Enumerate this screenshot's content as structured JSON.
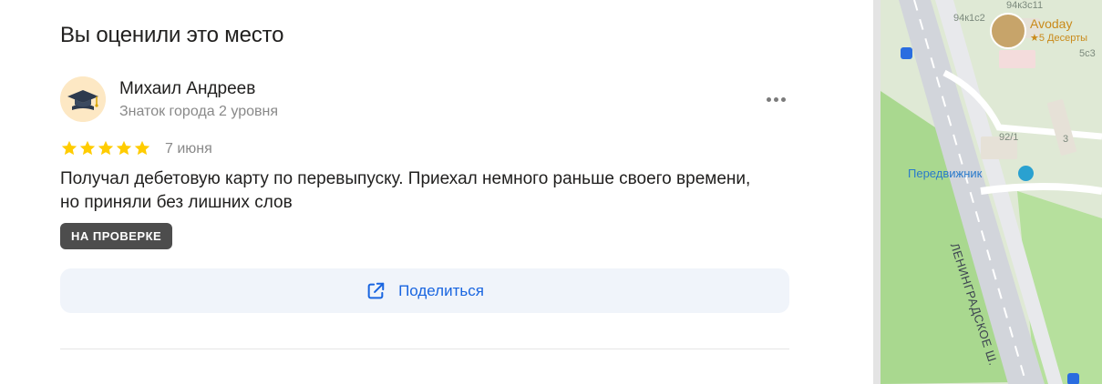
{
  "section": {
    "title": "Вы оценили это место"
  },
  "review": {
    "author_name": "Михаил Андреев",
    "author_level": "Знаток города 2 уровня",
    "rating": 5,
    "date": "7 июня",
    "text": "Получал дебетовую карту по перевыпуску. Приехал немного раньше своего времени, но приняли без лишних слов",
    "status": "НА ПРОВЕРКЕ"
  },
  "actions": {
    "share_label": "Поделиться"
  },
  "map": {
    "labels": {
      "building_top": "94к3с11",
      "building_1": "94к1с2",
      "building_2": "5с3",
      "building_3": "92/1",
      "building_4": "3",
      "street": "ЛЕНИНГРАДСКОЕ Ш.",
      "poi_name": "Передвижник",
      "cafe_name": "Avoday",
      "cafe_rating": "★5 Десерты"
    }
  },
  "colors": {
    "accent": "#1965e0",
    "star": "#fc0",
    "badge_bg": "#4d4d4d"
  }
}
